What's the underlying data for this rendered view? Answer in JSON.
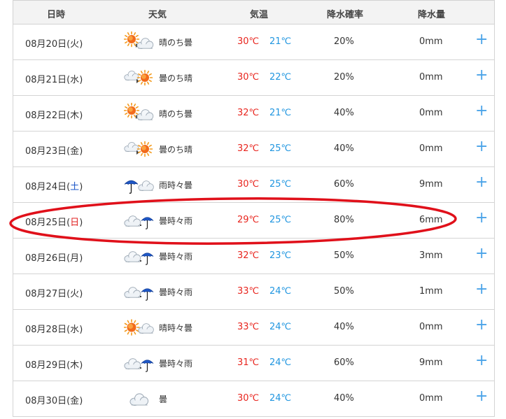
{
  "header": {
    "date": "日時",
    "weather": "天気",
    "temp": "気温",
    "pop": "降水確率",
    "rain": "降水量"
  },
  "rows": [
    {
      "date": "08月20日",
      "dow": "火",
      "dow_type": "weekday",
      "icon": "sun-then-cloud",
      "weather": "晴のち曇",
      "hi": "30℃",
      "lo": "21℃",
      "pop": "20%",
      "rain": "0mm",
      "expand": "+"
    },
    {
      "date": "08月21日",
      "dow": "水",
      "dow_type": "weekday",
      "icon": "cloud-then-sun",
      "weather": "曇のち晴",
      "hi": "30℃",
      "lo": "22℃",
      "pop": "20%",
      "rain": "0mm",
      "expand": "+"
    },
    {
      "date": "08月22日",
      "dow": "木",
      "dow_type": "weekday",
      "icon": "sun-then-cloud",
      "weather": "晴のち曇",
      "hi": "32℃",
      "lo": "21℃",
      "pop": "40%",
      "rain": "0mm",
      "expand": "+"
    },
    {
      "date": "08月23日",
      "dow": "金",
      "dow_type": "weekday",
      "icon": "cloud-then-sun",
      "weather": "曇のち晴",
      "hi": "32℃",
      "lo": "25℃",
      "pop": "40%",
      "rain": "0mm",
      "expand": "+"
    },
    {
      "date": "08月24日",
      "dow": "土",
      "dow_type": "saturday",
      "icon": "rain-sometimes-cloud",
      "weather": "雨時々曇",
      "hi": "30℃",
      "lo": "25℃",
      "pop": "60%",
      "rain": "9mm",
      "expand": "+"
    },
    {
      "date": "08月25日",
      "dow": "日",
      "dow_type": "sunday",
      "icon": "cloud-sometimes-rain",
      "weather": "曇時々雨",
      "hi": "29℃",
      "lo": "25℃",
      "pop": "80%",
      "rain": "6mm",
      "expand": "+"
    },
    {
      "date": "08月26日",
      "dow": "月",
      "dow_type": "weekday",
      "icon": "cloud-sometimes-rain",
      "weather": "曇時々雨",
      "hi": "32℃",
      "lo": "23℃",
      "pop": "50%",
      "rain": "3mm",
      "expand": "+"
    },
    {
      "date": "08月27日",
      "dow": "火",
      "dow_type": "weekday",
      "icon": "cloud-sometimes-rain",
      "weather": "曇時々雨",
      "hi": "33℃",
      "lo": "24℃",
      "pop": "50%",
      "rain": "1mm",
      "expand": "+"
    },
    {
      "date": "08月28日",
      "dow": "水",
      "dow_type": "weekday",
      "icon": "sun-sometimes-cloud",
      "weather": "晴時々曇",
      "hi": "33℃",
      "lo": "24℃",
      "pop": "40%",
      "rain": "0mm",
      "expand": "+"
    },
    {
      "date": "08月29日",
      "dow": "木",
      "dow_type": "weekday",
      "icon": "cloud-sometimes-rain",
      "weather": "曇時々雨",
      "hi": "31℃",
      "lo": "24℃",
      "pop": "60%",
      "rain": "9mm",
      "expand": "+"
    },
    {
      "date": "08月30日",
      "dow": "金",
      "dow_type": "weekday",
      "icon": "cloud",
      "weather": "曇",
      "hi": "30℃",
      "lo": "24℃",
      "pop": "40%",
      "rain": "0mm",
      "expand": "+"
    }
  ],
  "colors": {
    "temp_high": "#e8251e",
    "temp_low": "#2196e0",
    "saturday": "#1a55c8",
    "sunday": "#e02020",
    "expand": "#4aa3e8",
    "highlight_oval": "#e0101a"
  }
}
